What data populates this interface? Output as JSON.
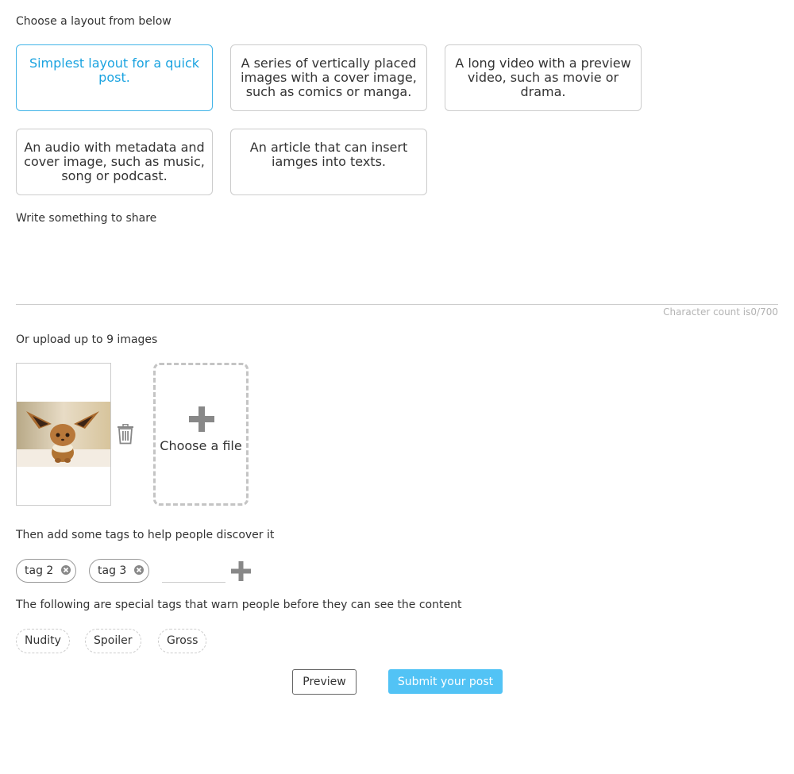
{
  "layout_section": {
    "label": "Choose a layout from below",
    "options": [
      {
        "text": "Simplest layout for a quick post.",
        "selected": true
      },
      {
        "text": "A series of vertically placed images with a cover image, such as comics or manga.",
        "selected": false
      },
      {
        "text": "A long video with a preview video, such as movie or drama.",
        "selected": false
      },
      {
        "text": "An audio with metadata and cover image, such as music, song or podcast.",
        "selected": false
      },
      {
        "text": "An article that can insert iamges into texts.",
        "selected": false
      }
    ]
  },
  "text_section": {
    "label": "Write something to share",
    "value": "",
    "char_count_prefix": "Character count is",
    "char_count_value": "0/700"
  },
  "upload_section": {
    "label": "Or upload up to 9 images",
    "images": [
      {
        "icon": "eevee-thumbnail"
      }
    ],
    "delete_icon": "trash-icon",
    "choose_label": "Choose a file",
    "add_icon": "plus-icon"
  },
  "tags_section": {
    "label": "Then add some tags to help people discover it",
    "tags": [
      "tag 2",
      "tag 3"
    ],
    "input_value": "",
    "remove_icon": "close-icon",
    "add_icon": "plus-icon"
  },
  "warning_section": {
    "label": "The following are special tags that warn people before they can see the content",
    "tags": [
      "Nudity",
      "Spoiler",
      "Gross"
    ]
  },
  "actions": {
    "preview_label": "Preview",
    "submit_label": "Submit your post"
  },
  "colors": {
    "accent": "#1aa3e0",
    "submit_bg": "#52c3f5",
    "border": "#cccccc"
  }
}
